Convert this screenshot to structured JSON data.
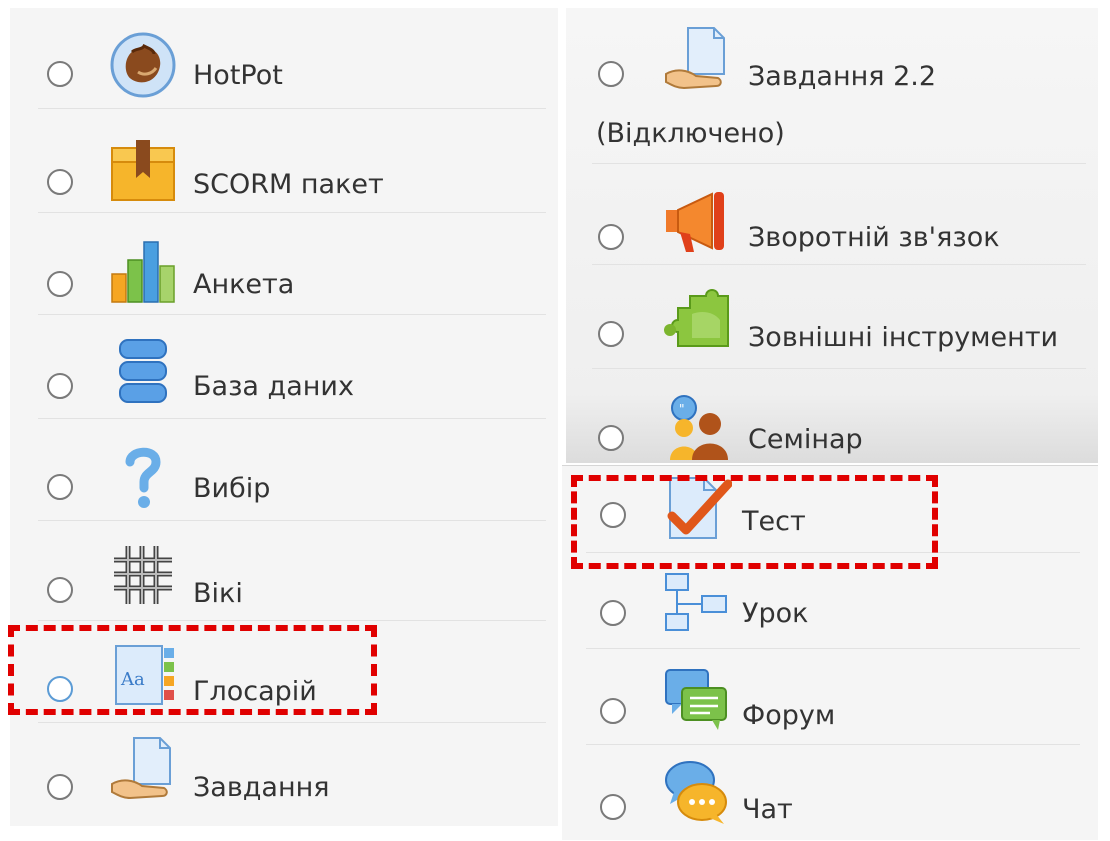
{
  "left_list": {
    "items": [
      {
        "label": "HotPot",
        "icon": "hotpot-icon"
      },
      {
        "label": "SCORM пакет",
        "icon": "scorm-package-icon"
      },
      {
        "label": "Анкета",
        "icon": "survey-chart-icon"
      },
      {
        "label": "База даних",
        "icon": "database-icon"
      },
      {
        "label": "Вибір",
        "icon": "question-mark-icon"
      },
      {
        "label": "Вікі",
        "icon": "wiki-icon"
      },
      {
        "label": "Глосарій",
        "icon": "glossary-icon",
        "highlighted": true
      },
      {
        "label": "Завдання",
        "icon": "assignment-icon"
      }
    ]
  },
  "right_top_list": {
    "items": [
      {
        "label": "Завдання 2.2",
        "sublabel": "(Відключено)",
        "icon": "assignment-icon"
      },
      {
        "label": "Зворотній зв'язок",
        "icon": "megaphone-icon"
      },
      {
        "label": "Зовнішні інструменти",
        "icon": "puzzle-icon"
      },
      {
        "label": "Семінар",
        "icon": "workshop-people-icon"
      }
    ]
  },
  "right_bottom_list": {
    "items": [
      {
        "label": "Тест",
        "icon": "quiz-checkmark-icon",
        "highlighted": true
      },
      {
        "label": "Урок",
        "icon": "lesson-flowchart-icon"
      },
      {
        "label": "Форум",
        "icon": "forum-icon"
      },
      {
        "label": "Чат",
        "icon": "chat-bubbles-icon"
      }
    ]
  },
  "colors": {
    "highlight_dash": "#e00000",
    "panel_bg": "#f5f5f5",
    "radio_border": "#7a7a7a"
  }
}
